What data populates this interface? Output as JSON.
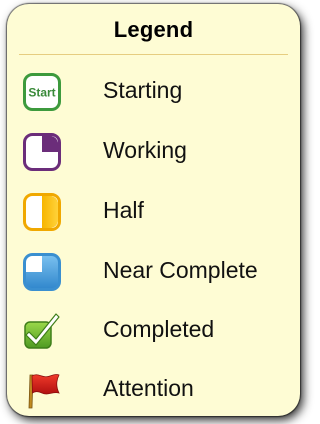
{
  "legend": {
    "title": "Legend",
    "items": [
      {
        "label": "Starting",
        "icon": "start-icon",
        "icon_text": "Start",
        "color": "#3d9a3d"
      },
      {
        "label": "Working",
        "icon": "quarter-progress-icon",
        "color": "#6b2d7a"
      },
      {
        "label": "Half",
        "icon": "half-progress-icon",
        "color": "#f0a800"
      },
      {
        "label": "Near Complete",
        "icon": "three-quarter-progress-icon",
        "color": "#3a8fd0"
      },
      {
        "label": "Completed",
        "icon": "checkmark-icon",
        "color": "#6ab832"
      },
      {
        "label": "Attention",
        "icon": "red-flag-icon",
        "color": "#d0201a"
      }
    ]
  },
  "colors": {
    "background": "#fefcd4",
    "divider": "#e6cd80"
  }
}
